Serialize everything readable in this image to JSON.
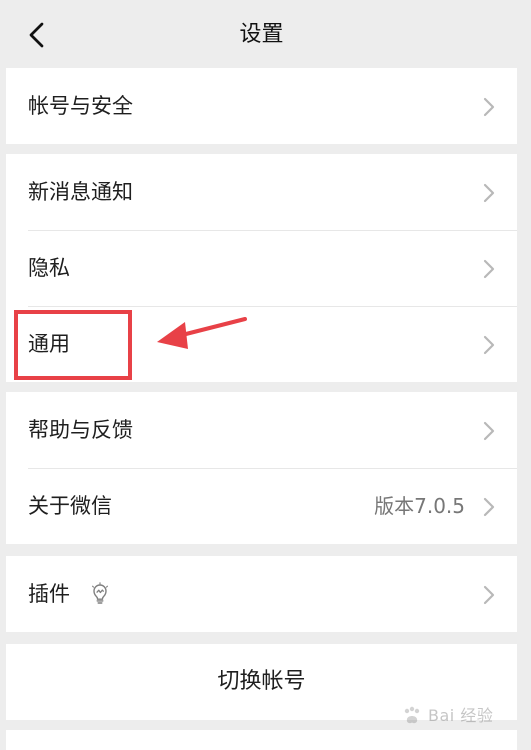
{
  "nav": {
    "title": "设置"
  },
  "account_security": {
    "label": "帐号与安全"
  },
  "notifications": {
    "label": "新消息通知"
  },
  "privacy": {
    "label": "隐私"
  },
  "general": {
    "label": "通用"
  },
  "help_feedback": {
    "label": "帮助与反馈"
  },
  "about": {
    "label": "关于微信",
    "version": "版本7.0.5"
  },
  "plugins": {
    "label": "插件"
  },
  "switch_account": {
    "label": "切换帐号"
  },
  "watermark": {
    "text": "Bai 经验"
  },
  "colors": {
    "background": "#ededed",
    "card": "#ffffff",
    "text": "#1f1f1f",
    "secondary_text": "#777777",
    "chevron": "#b8b8b8",
    "highlight": "#e84147"
  },
  "icons": {
    "back": "back-arrow-icon",
    "chevron": "chevron-right-icon",
    "plugin": "lightbulb-icon",
    "annotation_arrow": "red-arrow-icon",
    "watermark_paw": "baidu-paw-icon"
  }
}
